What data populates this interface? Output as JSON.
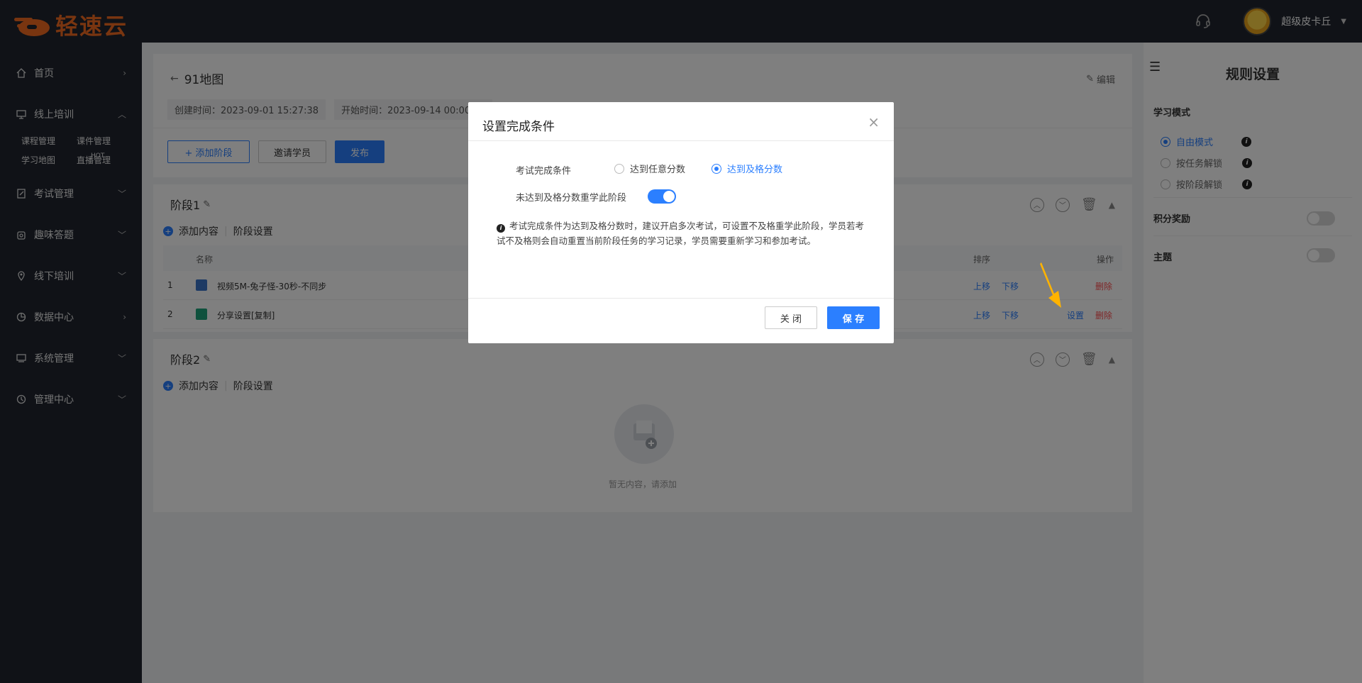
{
  "app": {
    "logo_text": "轻速云",
    "username": "超级皮卡丘"
  },
  "sidebar": {
    "items": [
      {
        "label": "首页"
      },
      {
        "label": "线上培训"
      },
      {
        "label": "考试管理"
      },
      {
        "label": "趣味答题"
      },
      {
        "label": "线下培训"
      },
      {
        "label": "数据中心"
      },
      {
        "label": "系统管理"
      },
      {
        "label": "管理中心"
      }
    ],
    "sub": {
      "course": "课程管理",
      "courseware": "课件管理",
      "map": "学习地图",
      "live": "直播管理",
      "hot": "HOT"
    }
  },
  "page": {
    "title": "91地图",
    "edit": "编辑",
    "created": "创建时间：2023-09-01 15:27:38",
    "start": "开始时间：2023-09-14 00:00:00",
    "add_stage": "+ 添加阶段",
    "invite": "邀请学员",
    "publish": "发布"
  },
  "stage1": {
    "title": "阶段1",
    "add_content": "添加内容",
    "stage_settings": "阶段设置",
    "col_name": "名称",
    "col_sort": "排序",
    "col_op": "操作",
    "rows": [
      {
        "no": "1",
        "name": "视频5M-兔子怪-30秒-不同步",
        "up": "上移",
        "down": "下移",
        "set": "",
        "del": "删除"
      },
      {
        "no": "2",
        "name": "分享设置[复制]",
        "up": "上移",
        "down": "下移",
        "set": "设置",
        "del": "删除"
      }
    ]
  },
  "stage2": {
    "title": "阶段2",
    "add_content": "添加内容",
    "stage_settings": "阶段设置",
    "empty": "暂无内容，请添加"
  },
  "rules": {
    "title": "规则设置",
    "learn_mode": "学习模式",
    "modes": [
      "自由模式",
      "按任务解锁",
      "按阶段解锁"
    ],
    "points": "积分奖励",
    "theme": "主题"
  },
  "modal": {
    "title": "设置完成条件",
    "cond_label": "考试完成条件",
    "opt_any": "达到任意分数",
    "opt_pass": "达到及格分数",
    "relearn_label": "未达到及格分数重学此阶段",
    "note": "考试完成条件为达到及格分数时，建议开启多次考试，可设置不及格重学此阶段，学员若考试不及格则会自动重置当前阶段任务的学习记录，学员需要重新学习和参加考试。",
    "close": "关 闭",
    "save": "保 存"
  },
  "colors": {
    "primary": "#2b7fff",
    "sidebar": "#20252f",
    "danger": "#ff4d4f",
    "brand": "#f26b21"
  }
}
